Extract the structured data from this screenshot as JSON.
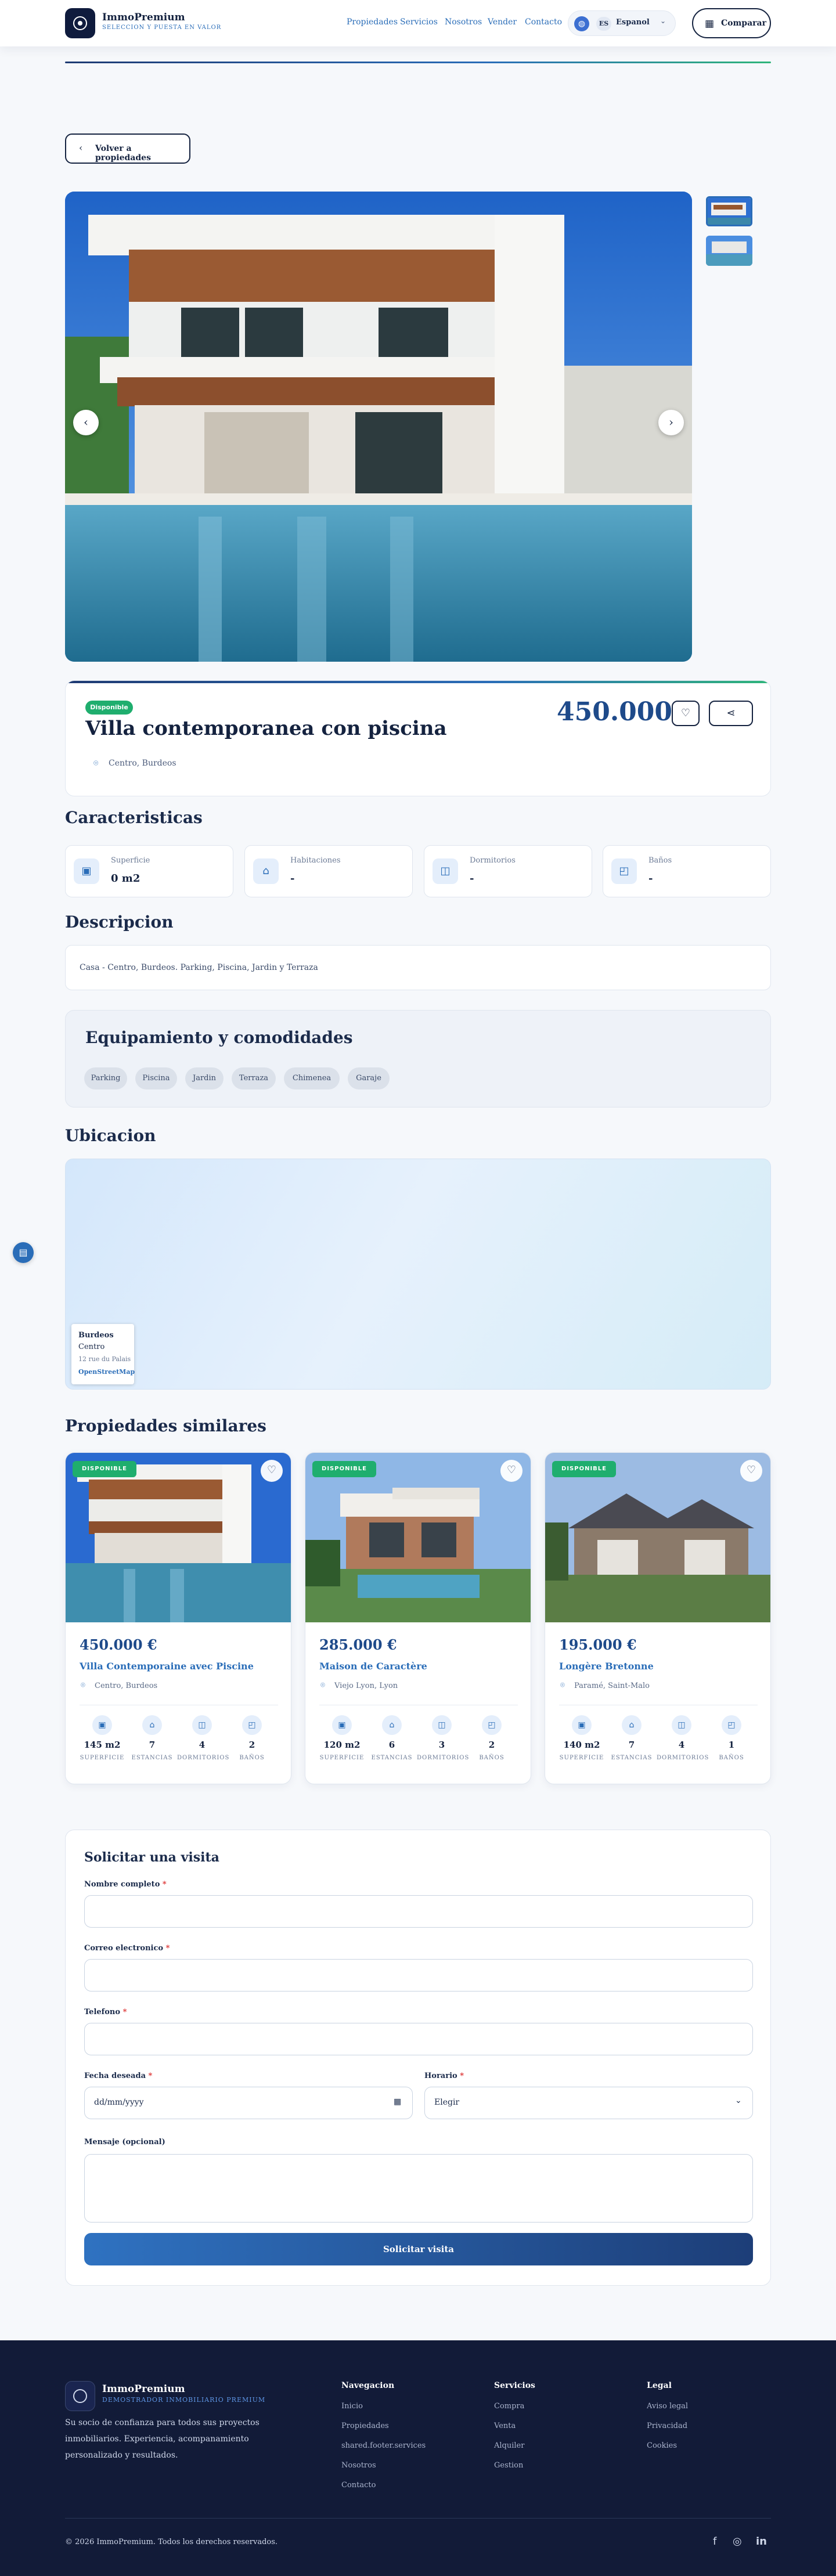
{
  "header": {
    "brand_name": "ImmoPremium",
    "brand_tagline": "SELECCION Y PUESTA EN VALOR",
    "nav": [
      "Propiedades",
      "Servicios",
      "Nosotros",
      "Vender",
      "Contacto"
    ],
    "lang_code": "ES",
    "lang_name": "Espanol",
    "compare_label": "Comparar"
  },
  "back_label": "Volver a propiedades",
  "property": {
    "status": "Disponible",
    "title": "Villa contemporanea con piscina",
    "location": "Centro, Burdeos",
    "price": "450.000 €"
  },
  "sections": {
    "features": "Caracteristicas",
    "description": "Descripcion",
    "equipment": "Equipamiento y comodidades",
    "location": "Ubicacion",
    "similar": "Propiedades similares"
  },
  "features": [
    {
      "label": "Superficie",
      "value": "0 m2",
      "icon": "area-icon"
    },
    {
      "label": "Habitaciones",
      "value": "-",
      "icon": "home-icon"
    },
    {
      "label": "Dormitorios",
      "value": "-",
      "icon": "bed-icon"
    },
    {
      "label": "Baños",
      "value": "-",
      "icon": "bath-icon"
    }
  ],
  "description": "Casa - Centro, Burdeos. Parking, Piscina, Jardin y Terraza",
  "equipment": [
    "Parking",
    "Piscina",
    "Jardin",
    "Terraza",
    "Chimenea",
    "Garaje"
  ],
  "map": {
    "city": "Burdeos",
    "zone": "Centro",
    "address": "12 rue du Palais",
    "attribution": "OpenStreetMap"
  },
  "similar": [
    {
      "badge": "DISPONIBLE",
      "price": "450.000 €",
      "title": "Villa Contemporaine avec Piscine",
      "location": "Centro, Burdeos",
      "stats": [
        "145 m2",
        "7",
        "4",
        "2"
      ]
    },
    {
      "badge": "DISPONIBLE",
      "price": "285.000 €",
      "title": "Maison de Caractère",
      "location": "Viejo Lyon, Lyon",
      "stats": [
        "120 m2",
        "6",
        "3",
        "2"
      ]
    },
    {
      "badge": "DISPONIBLE",
      "price": "195.000 €",
      "title": "Longère Bretonne",
      "location": "Paramé, Saint-Malo",
      "stats": [
        "140 m2",
        "7",
        "4",
        "1"
      ]
    }
  ],
  "stat_labels": [
    "SUPERFICIE",
    "ESTANCIAS",
    "DORMITORIOS",
    "BAÑOS"
  ],
  "form": {
    "title": "Solicitar una visita",
    "name_label": "Nombre completo",
    "email_label": "Correo electronico",
    "phone_label": "Telefono",
    "date_label": "Fecha deseada",
    "date_placeholder": "dd/mm/yyyy",
    "time_label": "Horario",
    "time_value": "Elegir",
    "message_label": "Mensaje (opcional)",
    "required_mark": "*",
    "submit": "Solicitar visita"
  },
  "footer": {
    "brand_name": "ImmoPremium",
    "brand_tagline": "DEMOSTRADOR INMOBILIARIO PREMIUM",
    "about": "Su socio de confianza para todos sus proyectos inmobiliarios. Experiencia, acompanamiento personalizado y resultados.",
    "col1_title": "Navegacion",
    "col1": [
      "Inicio",
      "Propiedades",
      "shared.footer.services",
      "Nosotros",
      "Contacto"
    ],
    "col2_title": "Servicios",
    "col2": [
      "Compra",
      "Venta",
      "Alquiler",
      "Gestion"
    ],
    "col3_title": "Legal",
    "col3": [
      "Aviso legal",
      "Privacidad",
      "Cookies"
    ],
    "copyright": "© 2026 ImmoPremium. Todos los derechos reservados.",
    "social": [
      "facebook-icon",
      "instagram-icon",
      "linkedin-icon"
    ]
  },
  "colors": {
    "navy": "#14223f",
    "accent": "#2a6db8",
    "green": "#1fae6e",
    "footer_bg": "#121b38"
  }
}
